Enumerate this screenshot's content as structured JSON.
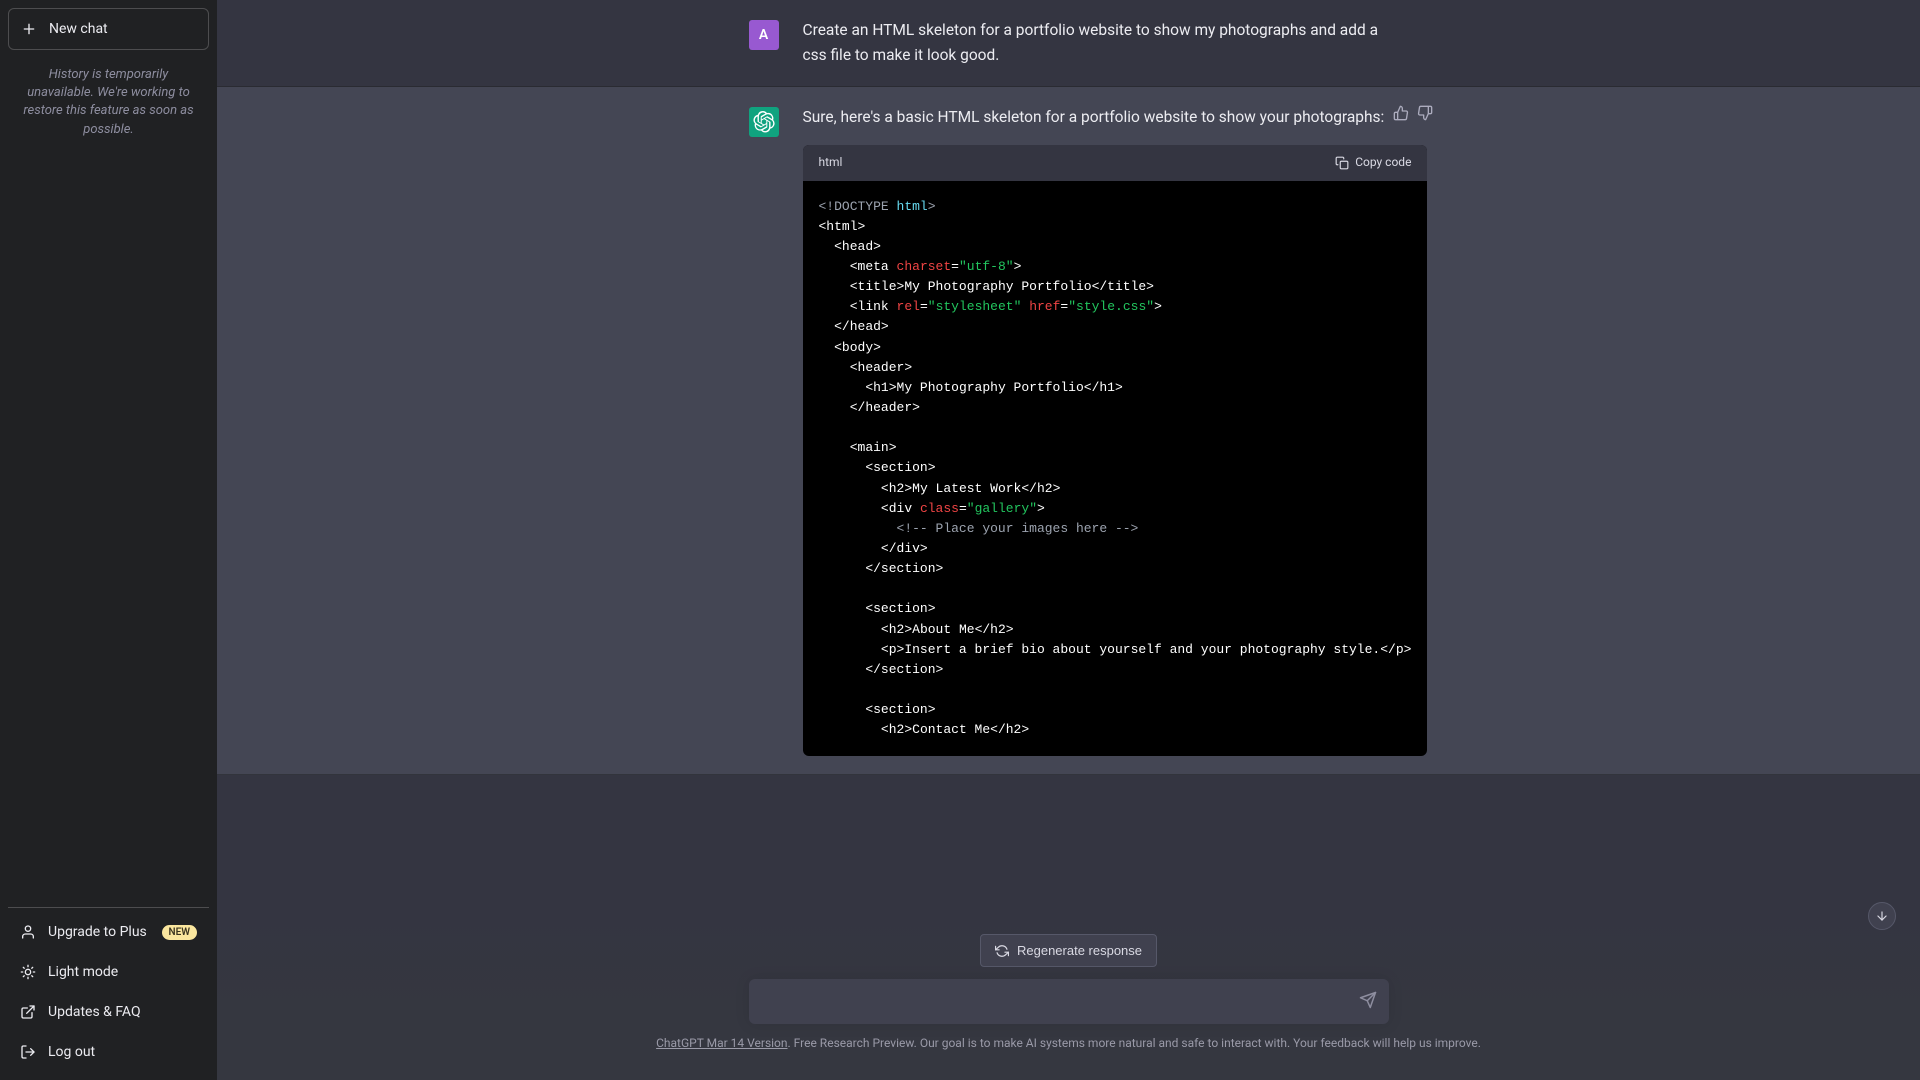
{
  "sidebar": {
    "new_chat": "New chat",
    "history_note": "History is temporarily unavailable. We're working to restore this feature as soon as possible.",
    "upgrade": "Upgrade to Plus",
    "upgrade_badge": "NEW",
    "light_mode": "Light mode",
    "updates": "Updates & FAQ",
    "logout": "Log out"
  },
  "chat": {
    "user_avatar_letter": "A",
    "user_msg": "Create an HTML skeleton for a portfolio website to show my photographs and add a css file to make it look good.",
    "assistant_msg": "Sure, here's a basic HTML skeleton for a portfolio website to show your photographs:",
    "code_lang": "html",
    "copy_label": "Copy code",
    "code": {
      "title_text": "My Photography Portfolio",
      "h1_text": "My Photography Portfolio",
      "h2_latest": "My Latest Work",
      "gallery_comment": "<!-- Place your images here -->",
      "h2_about": "About Me",
      "about_p": "Insert a brief bio about yourself and your photography style.",
      "h2_contact": "Contact Me",
      "charset": "\"utf-8\"",
      "rel": "\"stylesheet\"",
      "href": "\"style.css\"",
      "class_gallery": "\"gallery\""
    }
  },
  "bottom": {
    "regen": "Regenerate response",
    "version_link": "ChatGPT Mar 14 Version",
    "footer_rest": ". Free Research Preview. Our goal is to make AI systems more natural and safe to interact with. Your feedback will help us improve."
  }
}
